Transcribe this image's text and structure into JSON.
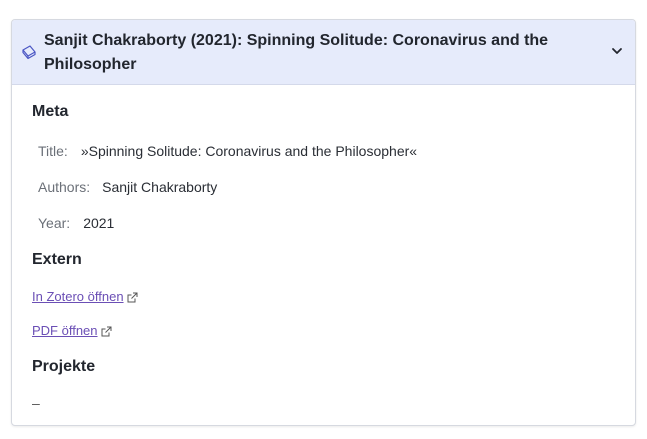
{
  "header": {
    "title": "Sanjit Chakraborty (2021): Spinning Solitude: Coronavirus and the Philosopher",
    "icon": "book-icon",
    "toggle_icon": "chevron-down-icon"
  },
  "meta": {
    "heading": "Meta",
    "rows": [
      {
        "label": "Title:",
        "value": "»Spinning Solitude: Coronavirus and the Philosopher«"
      },
      {
        "label": "Authors:",
        "value": "Sanjit Chakraborty"
      },
      {
        "label": "Year:",
        "value": "2021"
      }
    ]
  },
  "extern": {
    "heading": "Extern",
    "links": [
      {
        "label": "In Zotero öffnen",
        "icon": "external-link-icon"
      },
      {
        "label": "PDF öffnen",
        "icon": "external-link-icon"
      }
    ]
  },
  "projects": {
    "heading": "Projekte",
    "empty_text": "–"
  },
  "colors": {
    "header_bg": "#e6ebfb",
    "link": "#6b4fb5",
    "icon_accent": "#4b56c4"
  }
}
